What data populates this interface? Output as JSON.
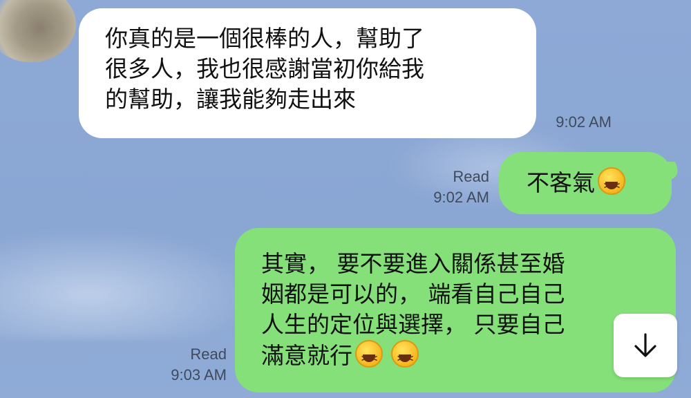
{
  "messages": [
    {
      "direction": "incoming",
      "lines": [
        "你真的是一個很棒的人，幫助了",
        "很多人，我也很感謝當初你給我",
        "的幫助，讓我能夠走出來"
      ],
      "time": "9:02 AM"
    },
    {
      "direction": "outgoing",
      "lines": [
        "不客氣"
      ],
      "emojis": [
        "grinning-squinting-face"
      ],
      "read": "Read",
      "time": "9:02 AM"
    },
    {
      "direction": "outgoing",
      "lines": [
        "其實， 要不要進入關係甚至婚",
        "姻都是可以的， 端看自己自己",
        "人生的定位與選擇， 只要自己",
        "滿意就行"
      ],
      "emojis": [
        "grinning-squinting-face",
        "grinning-squinting-face"
      ],
      "read": "Read",
      "time": "9:03 AM"
    }
  ],
  "scroll_button": {
    "icon": "arrow-down-icon"
  },
  "colors": {
    "background": "#8ea9d6",
    "incoming_bubble": "#ffffff",
    "outgoing_bubble": "#86e07a"
  }
}
